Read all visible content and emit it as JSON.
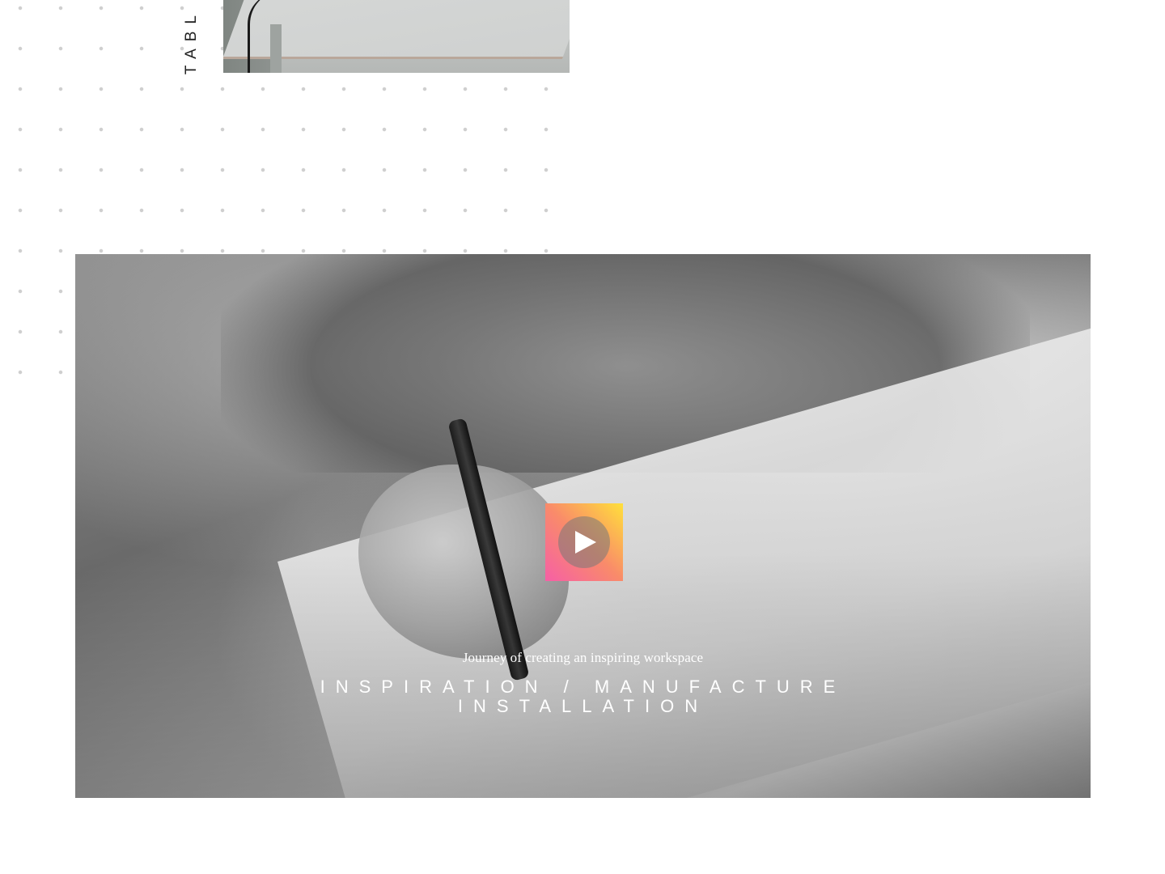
{
  "sidebar": {
    "vertical_label": "TABL"
  },
  "top_image": {
    "alt": "table product photo"
  },
  "hero": {
    "subtitle": "Journey of creating an inspiring workspace",
    "headline_line1": "INSPIRATION / MANUFACTURE",
    "headline_line2": "INSTALLATION",
    "play_icon": "play-icon"
  },
  "colors": {
    "accent_gradient_start": "#f65fa6",
    "accent_gradient_end": "#ffe03a",
    "background": "#ffffff",
    "dot": "#cfcfcf"
  }
}
